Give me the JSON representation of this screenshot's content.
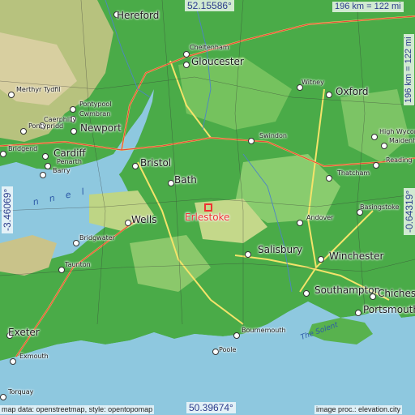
{
  "map": {
    "target": {
      "name": "Erlestoke",
      "color": "#e33333"
    },
    "coords": {
      "top_lat": "52.15586°",
      "bottom_lat": "50.39674°",
      "left_lon": "-3.46069°",
      "right_lon": "-0.64319°",
      "scale_km": "196 km = 122 mi",
      "scale_vertical": "196 km = 122 mi"
    },
    "cities": [
      {
        "name": "Hereford"
      },
      {
        "name": "Cheltenham"
      },
      {
        "name": "Gloucester"
      },
      {
        "name": "Merthyr Tydfil"
      },
      {
        "name": "Pontypool"
      },
      {
        "name": "Cwmbran"
      },
      {
        "name": "Newport"
      },
      {
        "name": "Caerphilly"
      },
      {
        "name": "Pontypridd"
      },
      {
        "name": "Penarth"
      },
      {
        "name": "Cardiff"
      },
      {
        "name": "Barry"
      },
      {
        "name": "Bristol"
      },
      {
        "name": "Bath"
      },
      {
        "name": "Wells"
      },
      {
        "name": "Bridgwater"
      },
      {
        "name": "Taunton"
      },
      {
        "name": "Witney"
      },
      {
        "name": "Oxford"
      },
      {
        "name": "Swindon"
      },
      {
        "name": "High Wycombe"
      },
      {
        "name": "Maidenhead"
      },
      {
        "name": "Reading"
      },
      {
        "name": "Thatcham"
      },
      {
        "name": "Basingstoke"
      },
      {
        "name": "Andover"
      },
      {
        "name": "Salisbury"
      },
      {
        "name": "Winchester"
      },
      {
        "name": "Southampton"
      },
      {
        "name": "Chichester"
      },
      {
        "name": "Portsmouth"
      },
      {
        "name": "Bournemouth"
      },
      {
        "name": "Poole"
      },
      {
        "name": "Exeter"
      },
      {
        "name": "Exmouth"
      },
      {
        "name": "Torquay"
      },
      {
        "name": "Bridgend"
      }
    ],
    "water_labels": {
      "solent": "The Solent",
      "channel_fragment": "n n e l"
    },
    "credits": {
      "left": "map data: openstreetmap, style: opentopomap",
      "right": "image proc.: elevation.city"
    }
  }
}
